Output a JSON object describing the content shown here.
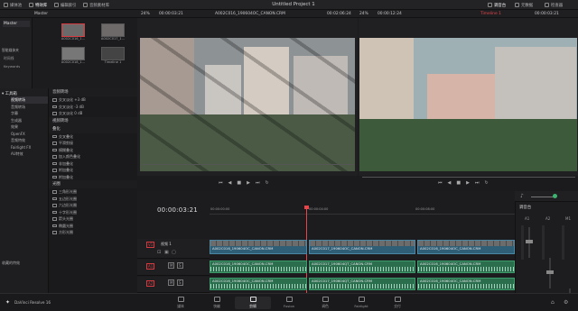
{
  "app": {
    "name": "DaVinci Resolve 16",
    "project_title": "Untitled Project 1"
  },
  "topbar": {
    "left": [
      {
        "label": "媒体池",
        "icon": "media-pool-icon"
      },
      {
        "label": "特效库",
        "icon": "effects-icon"
      },
      {
        "label": "编辑索引",
        "icon": "index-icon"
      },
      {
        "label": "音频素材库",
        "icon": "sound-library-icon"
      }
    ],
    "right": [
      {
        "label": "调音台",
        "icon": "mixer-icon"
      },
      {
        "label": "元数据",
        "icon": "metadata-icon"
      },
      {
        "label": "检查器",
        "icon": "inspector-icon"
      }
    ]
  },
  "subbar": {
    "pool_label": "Master",
    "zoom_left": "24%",
    "tc_left": "00:00:03:21",
    "clip_name": "A002C016_190604OC_CANON.CRM",
    "duration": "00:02:06:24",
    "tc_mid": "00:00:12:24",
    "zoom_right": "24%",
    "timeline_name": "Timeline 1",
    "tc_right": "00:00:03:21"
  },
  "media_pool": {
    "root": "Master",
    "smart_bins_title": "智能媒体夹",
    "smart_bins": [
      "时间线",
      "Keywords"
    ],
    "clips": [
      {
        "name": "A002C016_1...",
        "selected": true
      },
      {
        "name": "A002C017_1...",
        "selected": false
      },
      {
        "name": "A002C018_1...",
        "selected": false
      },
      {
        "name": "Timeline 1",
        "selected": false
      }
    ]
  },
  "effects": {
    "side_title": "工具箱",
    "side_items": [
      "视频转场",
      "音频转场",
      "字幕",
      "生成器",
      "效果",
      "OpenFX",
      "音频特效",
      "Fairlight FX",
      "AU特效"
    ],
    "favorites_label": "收藏的特效",
    "sections": [
      {
        "title": "音频转场",
        "items": [
          "交叉淡化 +3 dB",
          "交叉淡化 -3 dB",
          "交叉淡化 0 dB"
        ]
      },
      {
        "title": "视频转场",
        "items": []
      },
      {
        "title": "叠化",
        "items": [
          "交叉叠化",
          "平滑剪接",
          "模糊叠化",
          "加入颜色叠化",
          "非加叠化",
          "附加叠化",
          "附加叠化"
        ]
      },
      {
        "title": "光圈",
        "items": [
          "三角形光圈",
          "五边形光圈",
          "六边形光圈",
          "十字形光圈",
          "箭头光圈",
          "椭圆光圈",
          "方形光圈"
        ]
      }
    ]
  },
  "timeline": {
    "timecode": "00:00:03:21",
    "ruler": [
      "00:00:00:00",
      "00:00:04:00",
      "00:00:08:00"
    ],
    "video_track": {
      "id": "V1",
      "name": "视频 1",
      "clips": [
        "A002C016_190604OC_CANON.CRM",
        "A002C017_190604OC_CANON.CRM",
        "A002C016_190604OC_CANON.CRM"
      ]
    },
    "audio_tracks": [
      {
        "id": "A1",
        "clips": [
          "A002C016_190604OC_CANON.CRM",
          "A002C017_190604QT_CANON.CRM",
          "A002C016_190604OC_CANON.CRM"
        ]
      },
      {
        "id": "A2",
        "clips": [
          "A002C016_190604OC_CANON.CRM",
          "A002C017_190604QT_CANON.CRM",
          "A002C016_190604OC_CANON.CRM"
        ]
      }
    ]
  },
  "mixer": {
    "title": "调音台",
    "channels": [
      "A1",
      "A2",
      "M1"
    ]
  },
  "pages": [
    {
      "label": "媒体",
      "icon": "media-page-icon",
      "active": false
    },
    {
      "label": "快编",
      "icon": "cut-page-icon",
      "active": false
    },
    {
      "label": "剪辑",
      "icon": "edit-page-icon",
      "active": true
    },
    {
      "label": "Fusion",
      "icon": "fusion-page-icon",
      "active": false
    },
    {
      "label": "调色",
      "icon": "color-page-icon",
      "active": false
    },
    {
      "label": "Fairlight",
      "icon": "fairlight-page-icon",
      "active": false
    },
    {
      "label": "交付",
      "icon": "deliver-page-icon",
      "active": false
    }
  ],
  "colors": {
    "accent": "#e8454a",
    "video_clip": "#2f5f77",
    "audio_clip": "#2a6e4e",
    "playhead": "#e8454a"
  }
}
